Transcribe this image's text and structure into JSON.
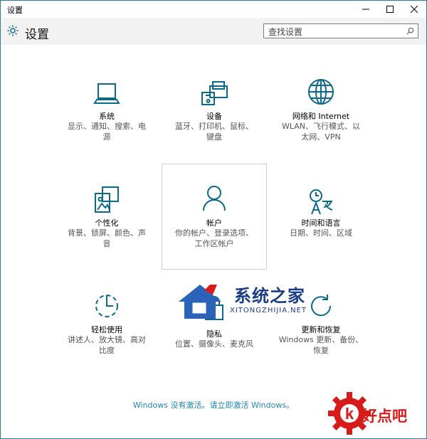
{
  "window": {
    "title": "设置",
    "minimize_glyph": "—",
    "maximize_glyph": "☐",
    "close_glyph": "✕"
  },
  "header": {
    "title": "设置",
    "icon": "gear-icon"
  },
  "search": {
    "placeholder": "查找设置"
  },
  "tiles": [
    {
      "title": "系统",
      "desc": [
        "显示、通知、搜索、电",
        "源"
      ],
      "icon": "laptop-icon"
    },
    {
      "title": "设备",
      "desc": [
        "蓝牙、打印机、鼠标、",
        "键盘"
      ],
      "icon": "devices-icon"
    },
    {
      "title": "网络和 Internet",
      "desc": [
        "WLAN、飞行模式、以",
        "太网、VPN"
      ],
      "icon": "globe-icon"
    },
    {
      "title": "个性化",
      "desc": [
        "背景、锁屏、颜色、声",
        "音"
      ],
      "icon": "personalize-icon"
    },
    {
      "title": "帐户",
      "desc": [
        "你的帐户、登录选项、",
        "工作区帐户"
      ],
      "icon": "person-icon"
    },
    {
      "title": "时间和语言",
      "desc": [
        "日期、时间、区域"
      ],
      "icon": "time-language-icon"
    },
    {
      "title": "轻松使用",
      "desc": [
        "讲述人、放大镜、高对",
        "比度"
      ],
      "icon": "ease-of-access-icon"
    },
    {
      "title": "隐私",
      "desc": [
        "位置、摄像头、麦克风"
      ],
      "icon": "lock-icon"
    },
    {
      "title": "更新和恢复",
      "desc": [
        "Windows 更新、备份、",
        "恢复"
      ],
      "icon": "refresh-icon"
    }
  ],
  "activation": {
    "text": "Windows 没有激活。请立即激活 Windows。"
  },
  "watermark": {
    "main": "系统之家",
    "url": "XITONGZHIJIA.NET"
  },
  "corner_logo": {
    "text": "好点吧"
  },
  "colors": {
    "accent": "#1f87b3",
    "icon": "#0b6a8c",
    "header_bg": "#f2f2f2"
  }
}
